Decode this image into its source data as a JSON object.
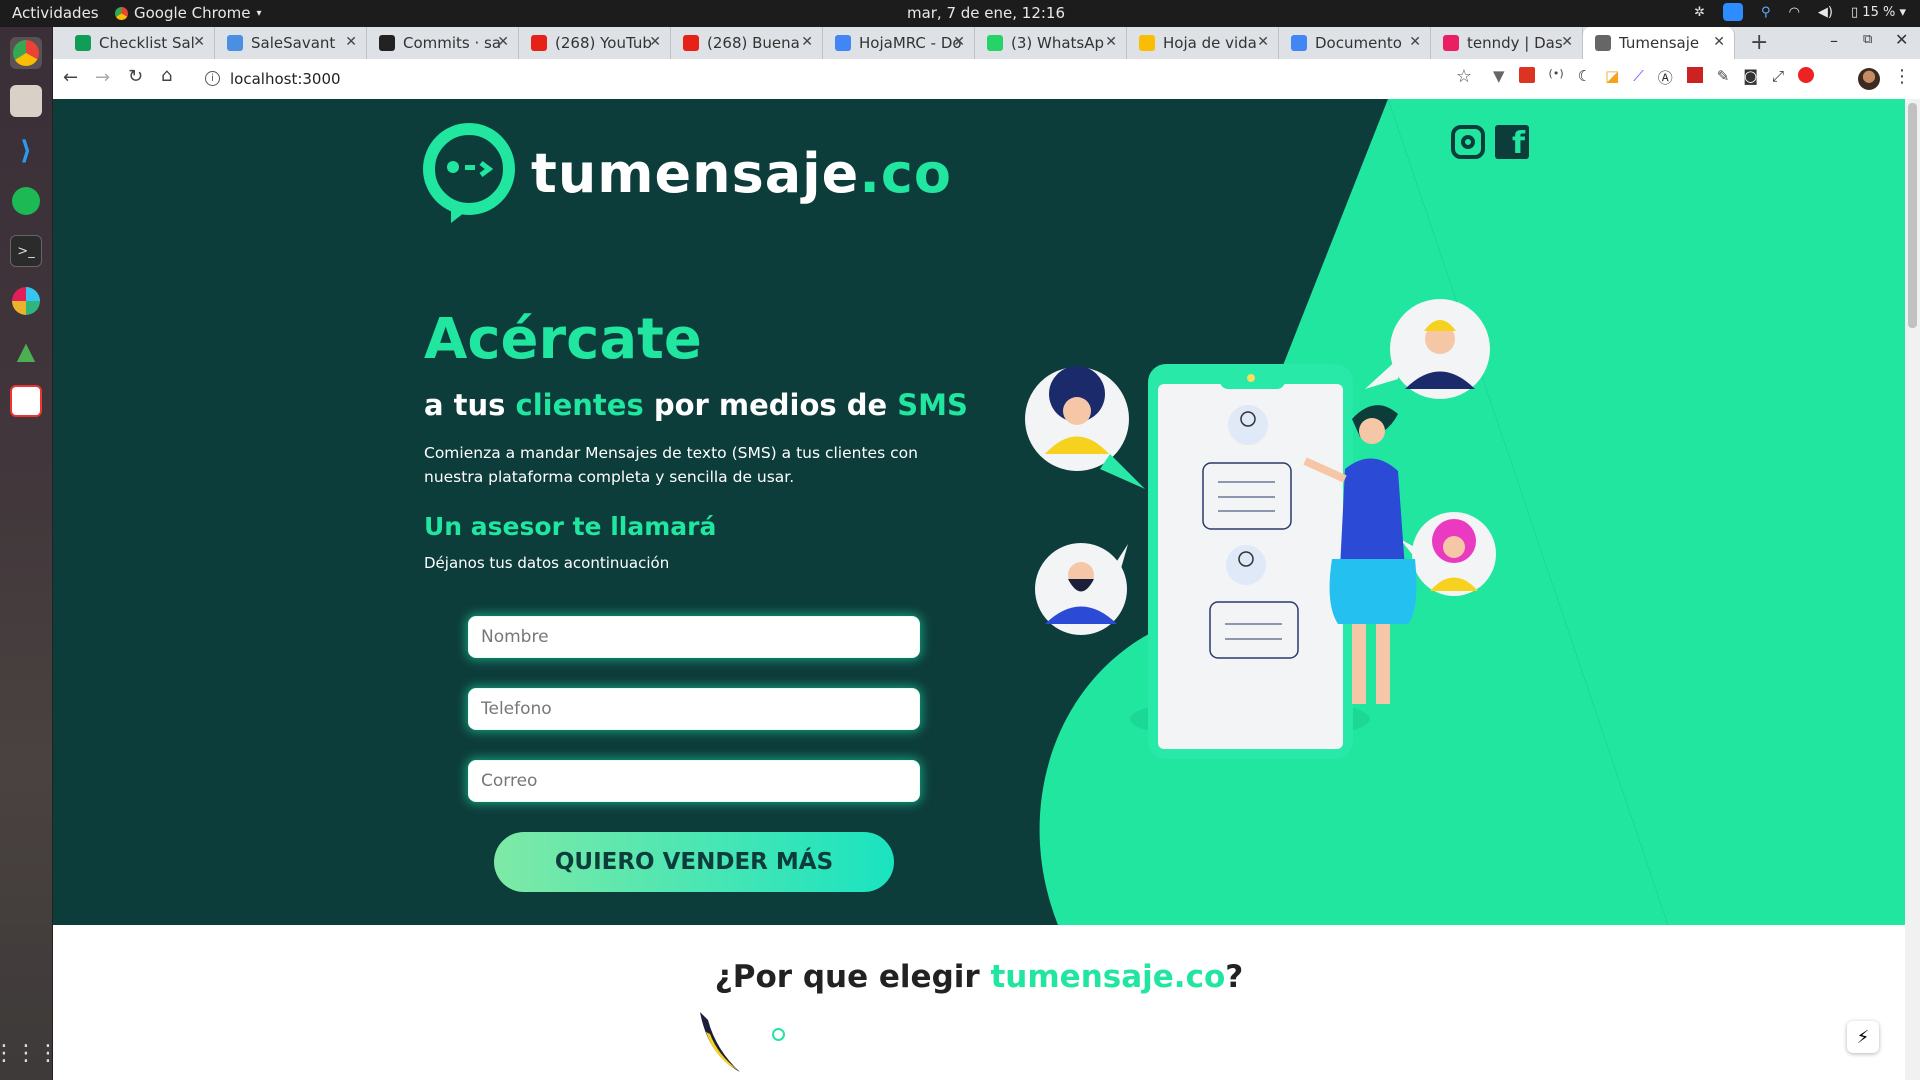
{
  "system": {
    "activities": "Actividades",
    "app": "Google Chrome",
    "clock": "mar,  7 de ene, 12:16",
    "battery": "15 %"
  },
  "tabs": [
    {
      "title": "Checklist Sal",
      "color": "#0f9d58"
    },
    {
      "title": "SaleSavant",
      "color": "#4a90e2"
    },
    {
      "title": "Commits · sa",
      "color": "#222222"
    },
    {
      "title": "(268) YouTub",
      "color": "#e62117"
    },
    {
      "title": "(268) Buena",
      "color": "#e62117"
    },
    {
      "title": "HojaMRC - Do",
      "color": "#4285f4"
    },
    {
      "title": "(3) WhatsAp",
      "color": "#25d366"
    },
    {
      "title": "Hoja de vida",
      "color": "#fbbc04"
    },
    {
      "title": "Documento",
      "color": "#4285f4"
    },
    {
      "title": "tenndy | Das",
      "color": "#e91e63"
    },
    {
      "title": "Tumensaje",
      "color": "#666666"
    }
  ],
  "address": "localhost:3000",
  "brand": {
    "name": "tumensaje",
    "tld": ".co"
  },
  "hero": {
    "title": "Acércate",
    "sub_a": "a tus ",
    "sub_b": "clientes",
    "sub_c": " por medios de ",
    "sub_d": "SMS",
    "desc": "Comienza a mandar Mensajes de texto (SMS) a tus clientes con nuestra plataforma completa y sencilla de usar.",
    "form_title": "Un asesor te llamará",
    "form_sub": "Déjanos tus datos acontinuación",
    "ph_name": "Nombre",
    "ph_phone": "Telefono",
    "ph_email": "Correo",
    "cta": "QUIERO VENDER MÁS"
  },
  "why": {
    "a": "¿Por que elegir ",
    "b": "tumensaje.co",
    "c": "?"
  },
  "colors": {
    "accent": "#21e6a0",
    "dark": "#0d3d3b"
  }
}
